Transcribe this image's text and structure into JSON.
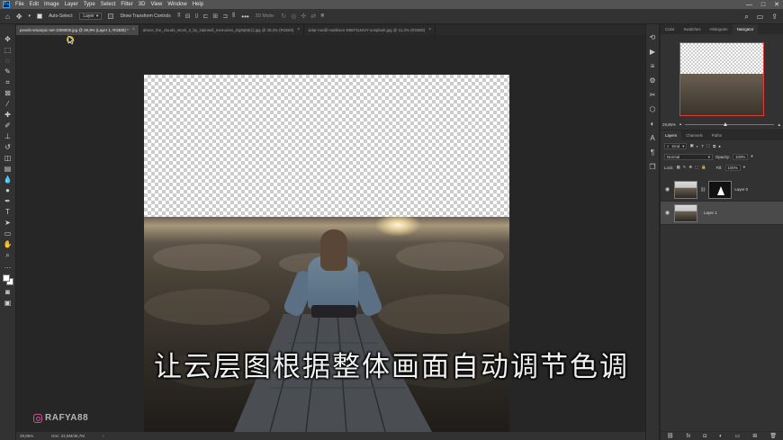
{
  "app": {
    "logo": "Ps",
    "menu": [
      "File",
      "Edit",
      "Image",
      "Layer",
      "Type",
      "Select",
      "Filter",
      "3D",
      "View",
      "Window",
      "Help"
    ],
    "window_controls": [
      "—",
      "□",
      "✕"
    ]
  },
  "options_bar": {
    "auto_select_label": "Auto-Select:",
    "auto_select_checked": true,
    "auto_select_target": "Layer",
    "show_transform_label": "Show Transform Controls",
    "show_transform_checked": false,
    "mode_3d_label": "3D Mode:",
    "more_icon": "ellipsis-icon"
  },
  "tabs": [
    {
      "label": "pexels-visionpic-net-1008000.jpg @ 29,9% (Layer 1, RGB/8) *",
      "active": true
    },
    {
      "label": "above_the_clouds_stock_2_by_stairwell_memories_d1j8q55(1).jpg @ 30,3% (RGB/8)",
      "active": false
    },
    {
      "label": "vidar-nordli-mathisen-D9873LMUY-unsplash.jpg @ 41,3% (RGB/8)",
      "active": false
    }
  ],
  "canvas": {
    "subtitle": "让云层图根据整体画面自动调节色调",
    "watermark": "RAFYA88"
  },
  "status_bar": {
    "zoom": "29,85%",
    "doc_info": "Doc: 22,5M/36,7M"
  },
  "navigator": {
    "tabs": [
      "Color",
      "Swatches",
      "Histogram",
      "Navigator"
    ],
    "active_tab": "Navigator",
    "zoom": "29,85%"
  },
  "layers_panel": {
    "tabs": [
      "Layers",
      "Channels",
      "Paths"
    ],
    "active_tab": "Layers",
    "filter_kind": "Kind",
    "blend_mode": "Normal",
    "opacity_label": "Opacity:",
    "opacity_value": "100%",
    "lock_label": "Lock:",
    "fill_label": "Fill:",
    "fill_value": "100%",
    "layers": [
      {
        "name": "Layer 0",
        "has_mask": true,
        "visible": true,
        "selected": false
      },
      {
        "name": "Layer 1",
        "has_mask": false,
        "visible": true,
        "selected": true
      }
    ]
  }
}
